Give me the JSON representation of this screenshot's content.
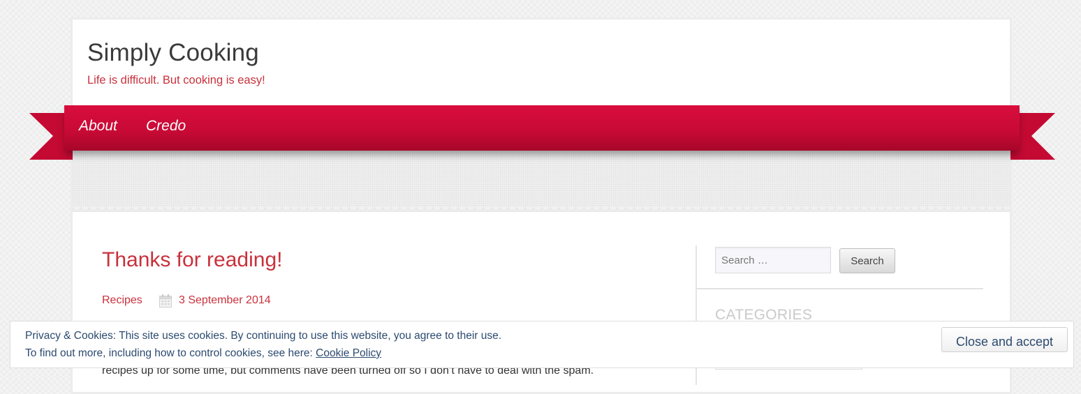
{
  "site": {
    "title": "Simply Cooking",
    "description": "Life is difficult. But cooking is easy!"
  },
  "nav": {
    "items": [
      {
        "label": "About"
      },
      {
        "label": "Credo"
      }
    ]
  },
  "post": {
    "title": "Thanks for reading!",
    "category": "Recipes",
    "date": "3 September 2014",
    "body_visible": "recipes up for some time, but comments have been turned off so I don’t have to deal with the spam."
  },
  "sidebar": {
    "search": {
      "placeholder": "Search …",
      "button_label": "Search"
    },
    "categories_title": "CATEGORIES"
  },
  "cookie_bar": {
    "line1": "Privacy & Cookies: This site uses cookies. By continuing to use this website, you agree to their use.",
    "line2_prefix": "To find out more, including how to control cookies, see here: ",
    "link_label": "Cookie Policy",
    "button_label": "Close and accept"
  },
  "colors": {
    "accent": "#c8313c",
    "ribbon": "#d20a38",
    "cookie_text": "#2c4a6f"
  },
  "icons": {
    "date": "calendar-icon"
  }
}
